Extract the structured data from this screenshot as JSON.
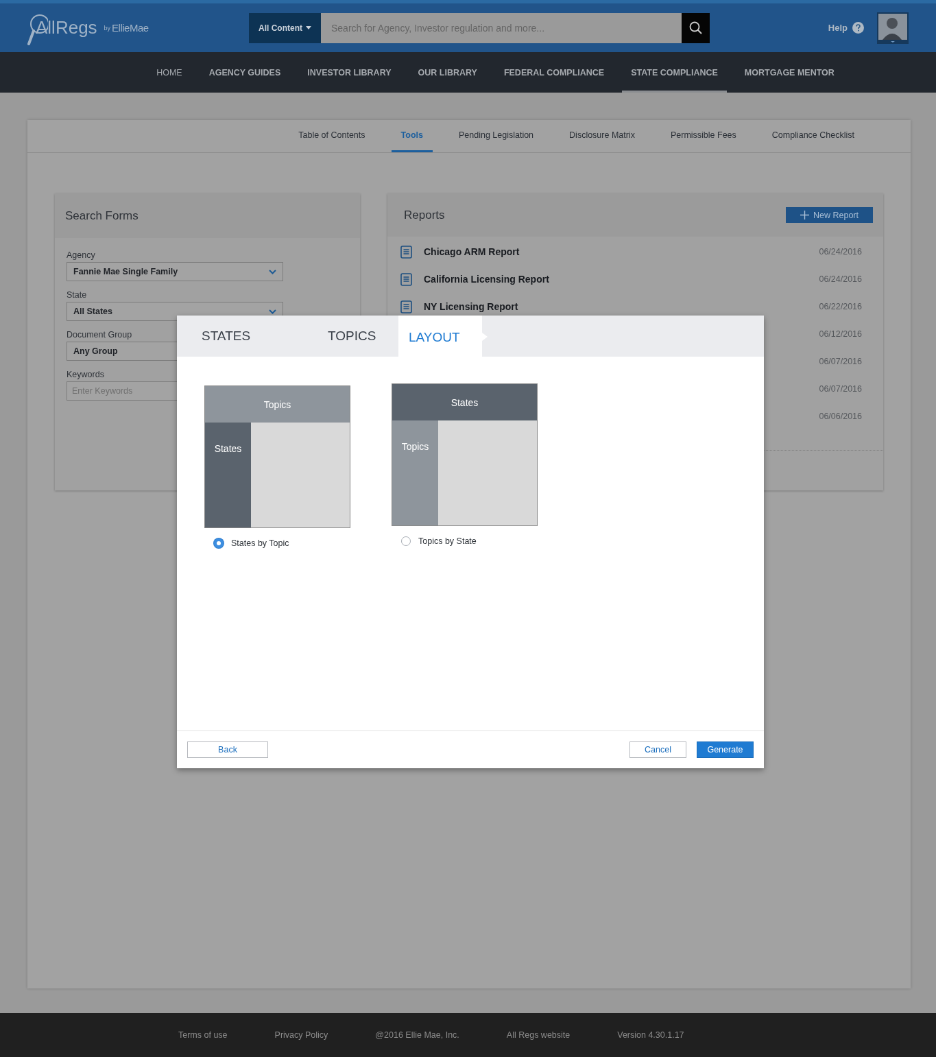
{
  "header": {
    "logo": "AllRegs",
    "logo_byline": "by",
    "logo_brand": "EllieMae",
    "scope_menu": "All Content",
    "search": {
      "placeholder": "Search for Agency, Investor regulation and more..."
    },
    "help": "Help"
  },
  "nav": [
    {
      "label": "HOME",
      "selected": false
    },
    {
      "label": "AGENCY GUIDES",
      "selected": false
    },
    {
      "label": "INVESTOR LIBRARY",
      "selected": false
    },
    {
      "label": "OUR LIBRARY",
      "selected": false
    },
    {
      "label": "FEDERAL COMPLIANCE",
      "selected": false
    },
    {
      "label": "STATE COMPLIANCE",
      "selected": true
    },
    {
      "label": "MORTGAGE MENTOR",
      "selected": false
    }
  ],
  "tabs": [
    {
      "label": "Table of Contents",
      "selected": false
    },
    {
      "label": "Tools",
      "selected": true
    },
    {
      "label": "Pending Legislation",
      "selected": false
    },
    {
      "label": "Disclosure Matrix",
      "selected": false
    },
    {
      "label": "Permissible Fees",
      "selected": false
    },
    {
      "label": "Compliance Checklist",
      "selected": false
    }
  ],
  "search_forms": {
    "title": "Search Forms",
    "fields": [
      {
        "label": "Agency",
        "kind": "select",
        "value": "Fannie Mae Single Family",
        "chevron": true
      },
      {
        "label": "State",
        "kind": "select",
        "value": "All States",
        "chevron": true
      },
      {
        "label": "Document Group",
        "kind": "select",
        "value": "Any Group"
      },
      {
        "label": "Keywords",
        "kind": "text",
        "placeholder": "Enter Keywords"
      }
    ]
  },
  "reports": {
    "title": "Reports",
    "new_button": "New Report",
    "rows": [
      {
        "name": "Chicago ARM Report",
        "date": "06/24/2016"
      },
      {
        "name": "California Licensing Report",
        "date": "06/24/2016"
      },
      {
        "name": "NY Licensing Report",
        "date": "06/22/2016"
      },
      {
        "date": "06/12/2016"
      },
      {
        "date": "06/07/2016"
      },
      {
        "date": "06/07/2016"
      },
      {
        "date": "06/06/2016"
      }
    ]
  },
  "dialog": {
    "steps": [
      {
        "label": "STATES",
        "selected": false
      },
      {
        "label": "TOPICS",
        "selected": false
      },
      {
        "label": "LAYOUT",
        "selected": true
      }
    ],
    "options": [
      {
        "kind": "topics-on-top",
        "top": "Topics",
        "side": "States",
        "label": "States by Topic",
        "selected": true
      },
      {
        "kind": "states-on-top",
        "top": "States",
        "side": "Topics",
        "label": "Topics by State",
        "selected": false
      }
    ],
    "back": "Back",
    "cancel": "Cancel",
    "generate": "Generate"
  },
  "footer": [
    "Terms of use",
    "Privacy Policy",
    "@2016 Ellie Mae, Inc.",
    "All Regs website",
    "Version 4.30.1.17"
  ]
}
